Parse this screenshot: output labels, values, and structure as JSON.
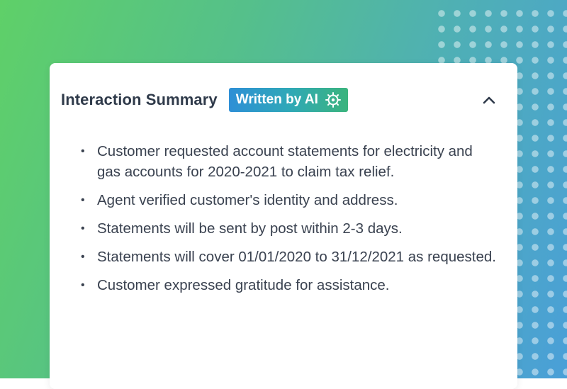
{
  "summary_panel": {
    "title": "Interaction Summary",
    "badge_label": "Written by AI",
    "badge_icon": "ai-brain-icon",
    "collapse_icon": "chevron-up-icon",
    "bullet_glyph": "•",
    "items": [
      "Customer requested account statements for electricity and gas accounts for 2020-2021 to claim tax relief.",
      "Agent verified customer's identity and address.",
      "Statements will be sent by post within 2-3 days.",
      "Statements will cover 01/01/2020 to 31/12/2021 as requested.",
      "Customer expressed gratitude for assistance."
    ]
  },
  "colors": {
    "background_start": "#5fd068",
    "background_end": "#4a9fd8",
    "title_text": "#2f3a4a",
    "body_text": "#3a4250",
    "badge_gradient_start": "#2e8fd6",
    "badge_gradient_end": "#3bb47d"
  }
}
